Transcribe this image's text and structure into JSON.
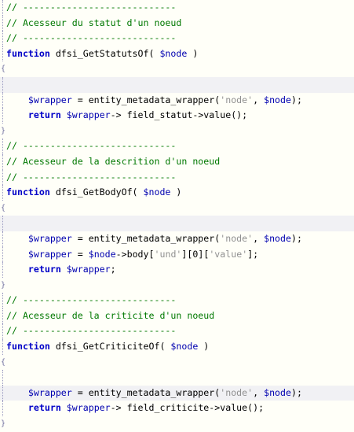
{
  "code_lines": [
    {
      "segments": [
        {
          "t": "// ----------------------------",
          "c": "comment"
        }
      ]
    },
    {
      "segments": [
        {
          "t": "// Acesseur du statut d'un noeud",
          "c": "comment"
        }
      ]
    },
    {
      "segments": [
        {
          "t": "// ----------------------------",
          "c": "comment"
        }
      ]
    },
    {
      "segments": [
        {
          "t": "function",
          "c": "kw"
        },
        {
          "t": " dfsi_GetStatutsOf( ",
          "c": "fn"
        },
        {
          "t": "$node",
          "c": "var"
        },
        {
          "t": " )",
          "c": "punct"
        }
      ]
    },
    {
      "gutter": "{",
      "segments": []
    },
    {
      "segments": []
    },
    {
      "segments": [
        {
          "t": "    ",
          "c": "punct"
        },
        {
          "t": "$wrapper",
          "c": "var"
        },
        {
          "t": " = entity_metadata_wrapper(",
          "c": "fn"
        },
        {
          "t": "'node'",
          "c": "str"
        },
        {
          "t": ", ",
          "c": "punct"
        },
        {
          "t": "$node",
          "c": "var"
        },
        {
          "t": ");",
          "c": "punct"
        }
      ]
    },
    {
      "segments": [
        {
          "t": "    ",
          "c": "punct"
        },
        {
          "t": "return",
          "c": "kw"
        },
        {
          "t": " ",
          "c": "punct"
        },
        {
          "t": "$wrapper",
          "c": "var"
        },
        {
          "t": "-> field_statut->value();",
          "c": "fn"
        }
      ]
    },
    {
      "gutter": "}",
      "segments": []
    },
    {
      "segments": [
        {
          "t": "// ----------------------------",
          "c": "comment"
        }
      ]
    },
    {
      "segments": [
        {
          "t": "// Acesseur de la descrition d'un noeud",
          "c": "comment"
        }
      ]
    },
    {
      "segments": [
        {
          "t": "// ----------------------------",
          "c": "comment"
        }
      ]
    },
    {
      "segments": [
        {
          "t": "function",
          "c": "kw"
        },
        {
          "t": " dfsi_GetBodyOf( ",
          "c": "fn"
        },
        {
          "t": "$node",
          "c": "var"
        },
        {
          "t": " )",
          "c": "punct"
        }
      ]
    },
    {
      "gutter": "{",
      "segments": []
    },
    {
      "segments": []
    },
    {
      "segments": [
        {
          "t": "    ",
          "c": "punct"
        },
        {
          "t": "$wrapper",
          "c": "var"
        },
        {
          "t": " = entity_metadata_wrapper(",
          "c": "fn"
        },
        {
          "t": "'node'",
          "c": "str"
        },
        {
          "t": ", ",
          "c": "punct"
        },
        {
          "t": "$node",
          "c": "var"
        },
        {
          "t": ");",
          "c": "punct"
        }
      ]
    },
    {
      "segments": [
        {
          "t": "    ",
          "c": "punct"
        },
        {
          "t": "$wrapper",
          "c": "var"
        },
        {
          "t": " = ",
          "c": "punct"
        },
        {
          "t": "$node",
          "c": "var"
        },
        {
          "t": "->body[",
          "c": "fn"
        },
        {
          "t": "'und'",
          "c": "str"
        },
        {
          "t": "][0][",
          "c": "punct"
        },
        {
          "t": "'value'",
          "c": "str"
        },
        {
          "t": "];",
          "c": "punct"
        }
      ]
    },
    {
      "segments": [
        {
          "t": "    ",
          "c": "punct"
        },
        {
          "t": "return",
          "c": "kw"
        },
        {
          "t": " ",
          "c": "punct"
        },
        {
          "t": "$wrapper",
          "c": "var"
        },
        {
          "t": ";",
          "c": "punct"
        }
      ]
    },
    {
      "gutter": "}",
      "segments": []
    },
    {
      "segments": [
        {
          "t": "// ----------------------------",
          "c": "comment"
        }
      ]
    },
    {
      "segments": [
        {
          "t": "// Acesseur de la criticite d'un noeud",
          "c": "comment"
        }
      ]
    },
    {
      "segments": [
        {
          "t": "// ----------------------------",
          "c": "comment"
        }
      ]
    },
    {
      "segments": [
        {
          "t": "function",
          "c": "kw"
        },
        {
          "t": " dfsi_GetCriticiteOf( ",
          "c": "fn"
        },
        {
          "t": "$node",
          "c": "var"
        },
        {
          "t": " )",
          "c": "punct"
        }
      ]
    },
    {
      "gutter": "{",
      "segments": []
    },
    {
      "segments": []
    },
    {
      "segments": [
        {
          "t": "    ",
          "c": "punct"
        },
        {
          "t": "$wrapper",
          "c": "var"
        },
        {
          "t": " = entity_metadata_wrapper(",
          "c": "fn"
        },
        {
          "t": "'node'",
          "c": "str"
        },
        {
          "t": ", ",
          "c": "punct"
        },
        {
          "t": "$node",
          "c": "var"
        },
        {
          "t": ");",
          "c": "punct"
        }
      ]
    },
    {
      "segments": [
        {
          "t": "    ",
          "c": "punct"
        },
        {
          "t": "return",
          "c": "kw"
        },
        {
          "t": " ",
          "c": "punct"
        },
        {
          "t": "$wrapper",
          "c": "var"
        },
        {
          "t": "-> field_criticite->value();",
          "c": "fn"
        }
      ]
    },
    {
      "gutter": "}",
      "segments": []
    }
  ],
  "colors": {
    "background": "#fffff8",
    "comment": "#007800",
    "keyword": "#0000c8",
    "variable": "#0000b0",
    "string": "#909090"
  }
}
